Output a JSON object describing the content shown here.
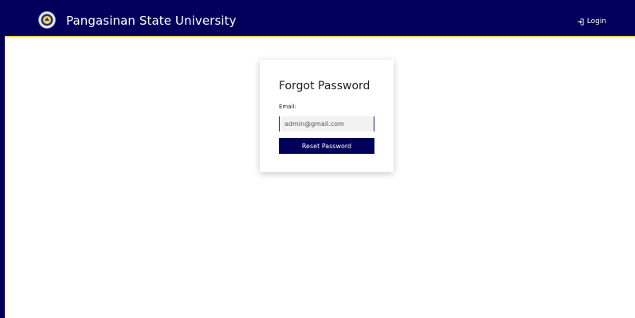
{
  "navbar": {
    "brand_title": "Pangasinan State University",
    "login_label": "Login",
    "login_icon": "login-icon",
    "seal_icon": "university-seal-icon"
  },
  "form": {
    "title": "Forgot Password",
    "email_label": "Email:",
    "email_value": "admin@gmail.com",
    "submit_label": "Reset Password"
  },
  "colors": {
    "primary": "#02005a",
    "accent": "#e8d35a",
    "background": "#ffffff"
  }
}
